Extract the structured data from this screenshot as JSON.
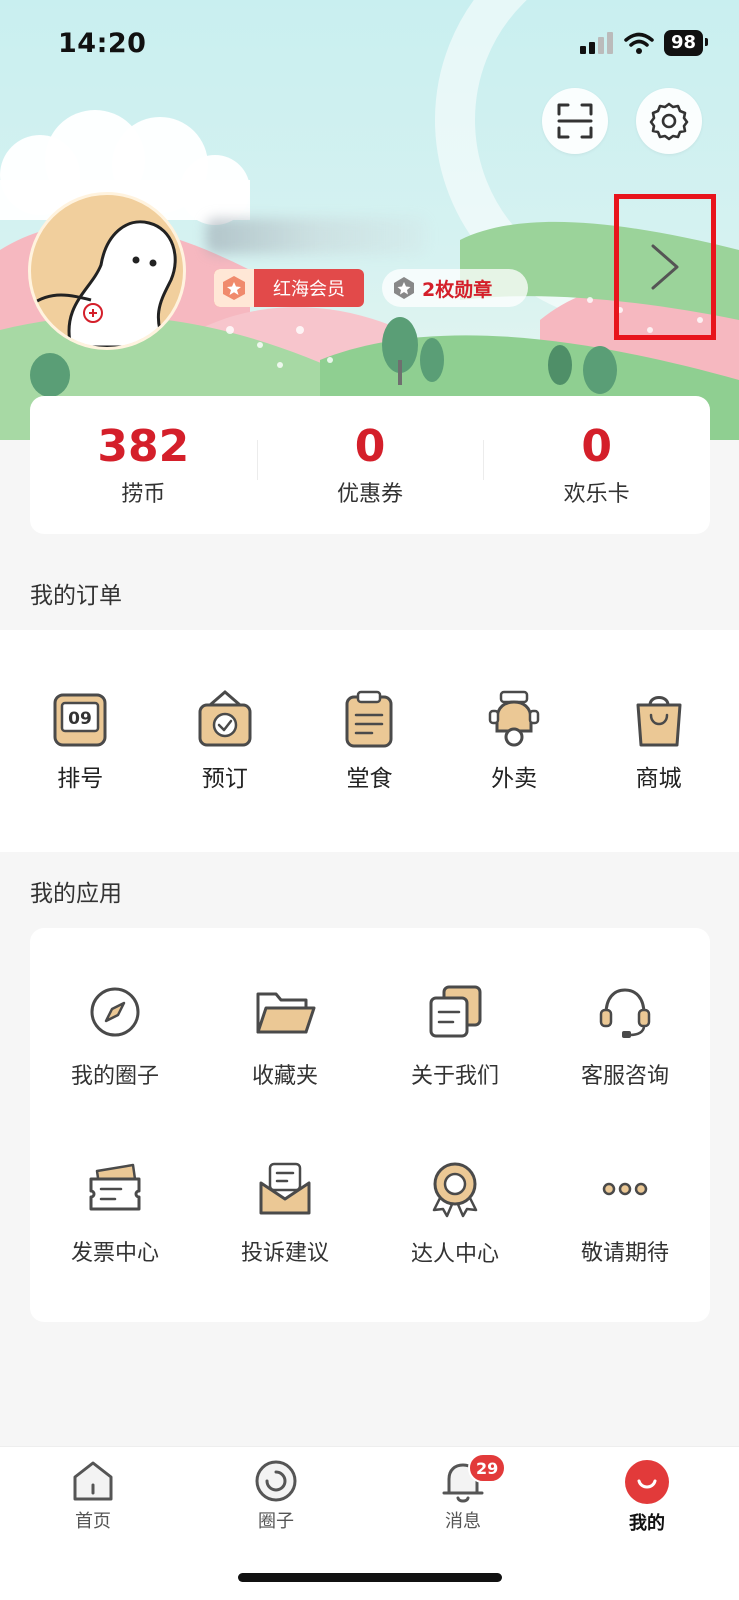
{
  "status_bar": {
    "time": "14:20",
    "battery": "98"
  },
  "header": {
    "scan_icon": "scan-icon",
    "settings_icon": "gear-icon",
    "member_badge": "红海会员",
    "medal_badge": "2枚勋章",
    "profile_arrow_icon": "chevron-right-icon"
  },
  "stats": [
    {
      "value": "382",
      "label": "捞币"
    },
    {
      "value": "0",
      "label": "优惠券"
    },
    {
      "value": "0",
      "label": "欢乐卡"
    }
  ],
  "orders": {
    "title": "我的订单",
    "items": [
      {
        "label": "排号",
        "icon": "queue-number-icon",
        "icon_text": "09"
      },
      {
        "label": "预订",
        "icon": "reservation-icon"
      },
      {
        "label": "堂食",
        "icon": "dine-in-icon"
      },
      {
        "label": "外卖",
        "icon": "delivery-scooter-icon"
      },
      {
        "label": "商城",
        "icon": "shopping-bag-icon"
      }
    ]
  },
  "apps": {
    "title": "我的应用",
    "items": [
      {
        "label": "我的圈子",
        "icon": "compass-icon"
      },
      {
        "label": "收藏夹",
        "icon": "folder-icon"
      },
      {
        "label": "关于我们",
        "icon": "document-stack-icon"
      },
      {
        "label": "客服咨询",
        "icon": "headset-icon"
      },
      {
        "label": "发票中心",
        "icon": "invoice-icon"
      },
      {
        "label": "投诉建议",
        "icon": "mail-icon"
      },
      {
        "label": "达人中心",
        "icon": "award-icon"
      },
      {
        "label": "敬请期待",
        "icon": "more-icon"
      }
    ]
  },
  "tabbar": {
    "items": [
      {
        "label": "首页",
        "icon": "home-icon"
      },
      {
        "label": "圈子",
        "icon": "circle-icon"
      },
      {
        "label": "消息",
        "icon": "bell-icon",
        "badge": "29"
      },
      {
        "label": "我的",
        "icon": "profile-smile-icon",
        "active": true
      }
    ]
  },
  "colors": {
    "accent": "#d41f2a",
    "icon_fill": "#ebc895",
    "icon_stroke": "#4a4a4a"
  }
}
